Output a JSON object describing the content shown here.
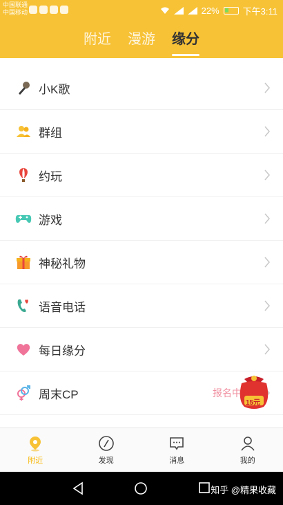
{
  "status_bar": {
    "carrier_1": "中国联通",
    "carrier_2": "中国移动",
    "battery": "22%",
    "time": "下午3:11"
  },
  "top_tabs": [
    {
      "label": "附近",
      "active": false
    },
    {
      "label": "漫游",
      "active": false
    },
    {
      "label": "缘分",
      "active": true
    }
  ],
  "list": [
    {
      "label": "小K歌",
      "icon": "microphone-icon"
    },
    {
      "label": "群组",
      "icon": "group-icon"
    },
    {
      "label": "约玩",
      "icon": "hot-air-balloon-icon"
    },
    {
      "label": "游戏",
      "icon": "gamepad-icon"
    },
    {
      "label": "神秘礼物",
      "icon": "gift-box-icon"
    },
    {
      "label": "语音电话",
      "icon": "phone-heart-icon"
    },
    {
      "label": "每日缘分",
      "icon": "heart-icon"
    },
    {
      "label": "周末CP",
      "icon": "gender-symbols-icon",
      "badge": "报名中"
    }
  ],
  "red_packet": {
    "amount": "15元"
  },
  "bottom_nav": [
    {
      "label": "附近",
      "icon": "location-pin-icon",
      "active": true
    },
    {
      "label": "发现",
      "icon": "compass-icon",
      "active": false
    },
    {
      "label": "消息",
      "icon": "chat-bubble-icon",
      "active": false
    },
    {
      "label": "我的",
      "icon": "person-icon",
      "active": false
    }
  ],
  "watermark": "知乎 @精果收藏",
  "colors": {
    "accent": "#f7c236",
    "active_nav": "#f7b500"
  }
}
